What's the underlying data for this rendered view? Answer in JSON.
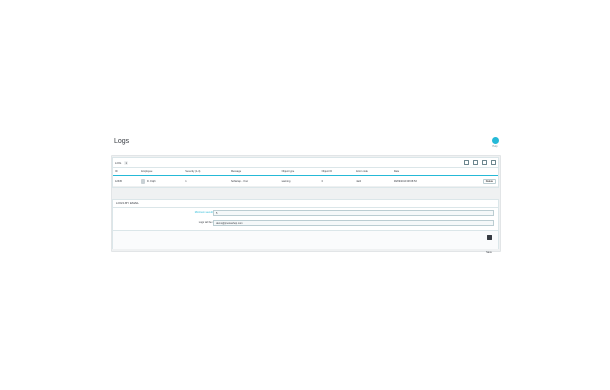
{
  "page": {
    "title": "Logs"
  },
  "help": {
    "label": "Help"
  },
  "logs_list": {
    "header_label": "LOG",
    "count": "1",
    "columns": [
      "ID",
      "Employee",
      "Severity (1-4)",
      "Message",
      "Object type",
      "Object ID",
      "Error code",
      "Date"
    ],
    "rows": [
      {
        "id": "12345",
        "employee": "D. Fiqih",
        "severity": "1",
        "message": "Softwrap - Your",
        "object_type": "warning",
        "object_id": "0",
        "error_code": "4a/4",
        "date": "09/09/2019 08:08:53",
        "action_label": "Delete"
      }
    ]
  },
  "logs_by_email": {
    "section_title": "LOGS BY EMAIL",
    "min_severity_label": "Minimum severity level",
    "min_severity_value": "5",
    "send_to_label": "Logs will be sent to",
    "send_to_value": "demo@prestashop.com"
  },
  "footer": {
    "save_label": "Save"
  }
}
